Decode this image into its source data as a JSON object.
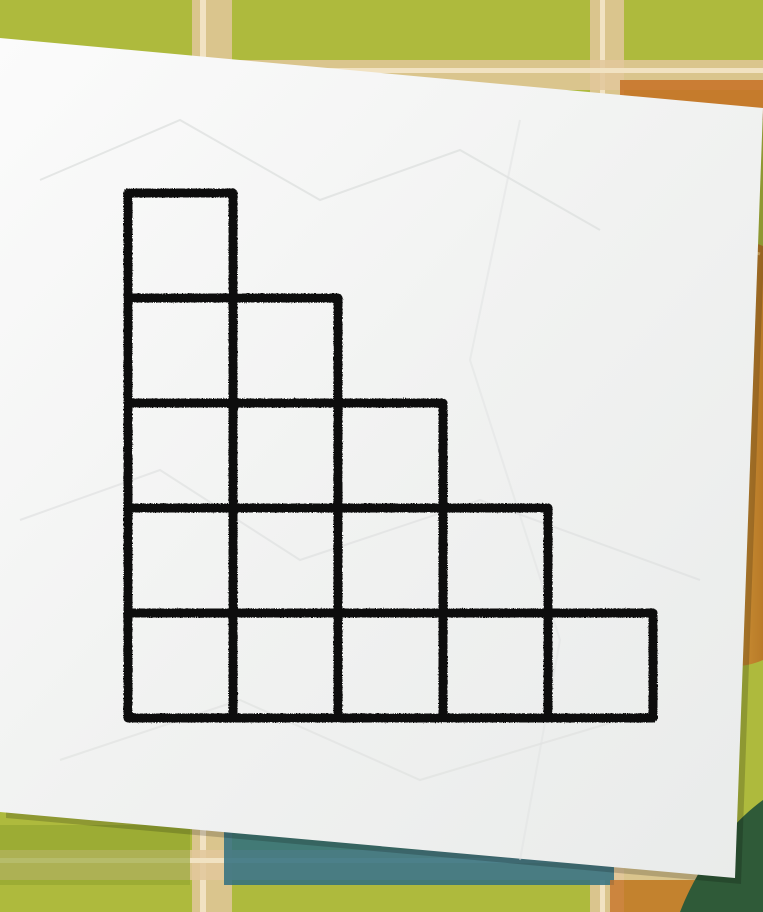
{
  "puzzle": {
    "kind": "staircase square grid",
    "columns": 5,
    "rows": 5,
    "column_heights": [
      5,
      4,
      3,
      2,
      1
    ],
    "total_unit_squares": 15
  },
  "palette": {
    "tablecloth_green": "#a9b63a",
    "tablecloth_stripe": "#e2c79b",
    "tablecloth_orange": "#c8742a",
    "tablecloth_teal": "#2f6f80",
    "paper": "#f4f5f4",
    "ink": "#111111",
    "wood": "#d49a3a",
    "foliage": "#2f5a38"
  },
  "icons": {
    "drawing": "hand-drawn-grid",
    "background": "plaid-tablecloth",
    "prop": "wooden-block"
  }
}
